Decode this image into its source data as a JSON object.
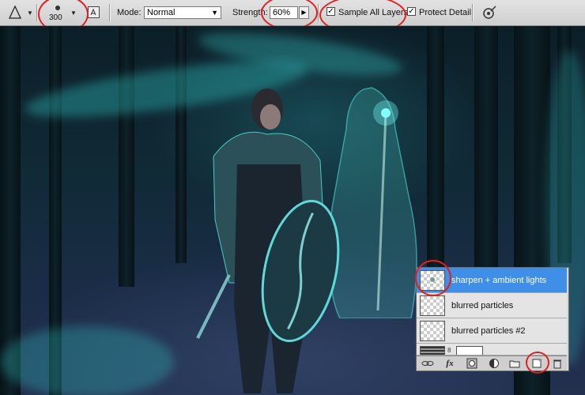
{
  "toolbar": {
    "tool_icon": "sharpen-tool-icon",
    "brush_size": "300",
    "mode_label": "Mode:",
    "mode_value": "Normal",
    "strength_label": "Strength:",
    "strength_value": "60%",
    "sample_all_layers_label": "Sample All Layers",
    "sample_all_layers_checked": true,
    "protect_detail_label": "Protect Detail",
    "protect_detail_checked": true
  },
  "layers_panel": {
    "layers": [
      {
        "name": "sharpen + ambient lights",
        "selected": true
      },
      {
        "name": "blurred particles",
        "selected": false
      },
      {
        "name": "blurred particles #2",
        "selected": false
      },
      {
        "name": "",
        "selected": false
      }
    ],
    "footer_icons": [
      "link-icon",
      "fx-icon",
      "mask-icon",
      "adjustment-icon",
      "folder-icon",
      "new-layer-icon",
      "trash-icon"
    ],
    "fx_label": "fx"
  },
  "colors": {
    "highlight": "#e02020",
    "selected_layer": "#3f8ee8",
    "glow": "#30e0d8"
  }
}
